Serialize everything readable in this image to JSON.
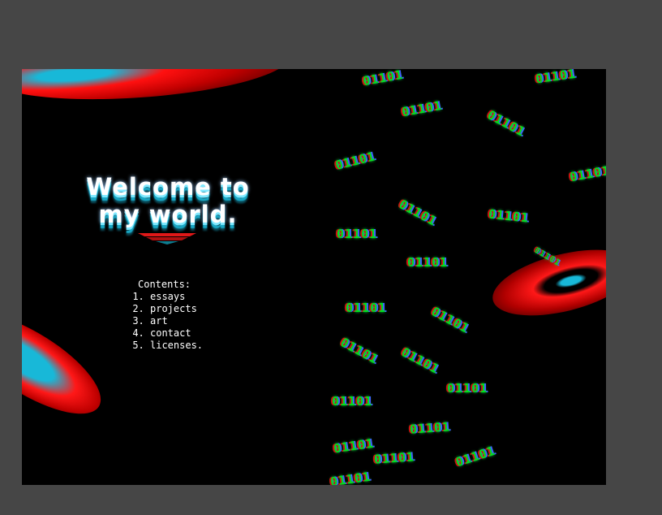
{
  "title": {
    "line1": "Welcome to",
    "line2": "my world."
  },
  "contents": {
    "heading": "Contents:",
    "items": [
      "essays",
      "projects",
      "art",
      "contact",
      "licenses."
    ]
  },
  "binary_glyphs": "01101",
  "colors": {
    "frame": "#464646",
    "canvas": "#000000",
    "glow_red": "#ff1010",
    "glow_cyan": "#18b8d8",
    "binary_green": "#00e020"
  }
}
